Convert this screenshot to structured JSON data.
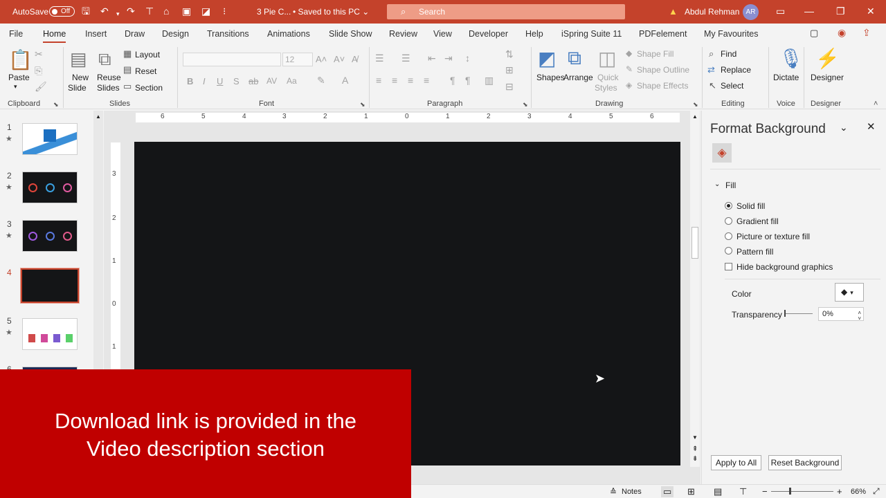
{
  "titlebar": {
    "autosave": "AutoSave",
    "toggle": "Off",
    "doc_title": "3 Pie C...",
    "saved": "• Saved to this PC ⌄",
    "search_placeholder": "Search",
    "user": "Abdul Rehman",
    "avatar": "AR",
    "accent": "#c4422b"
  },
  "tabs": [
    "File",
    "Home",
    "Insert",
    "Draw",
    "Design",
    "Transitions",
    "Animations",
    "Slide Show",
    "Review",
    "View",
    "Developer",
    "Help",
    "iSpring Suite 11",
    "PDFelement",
    "My Favourites"
  ],
  "ribbon": {
    "clipboard": {
      "paste": "Paste",
      "group": "Clipboard"
    },
    "slides": {
      "new_slide": "New",
      "new_slide2": "Slide",
      "reuse": "Reuse",
      "reuse2": "Slides",
      "layout": "Layout",
      "reset": "Reset",
      "section": "Section",
      "group": "Slides"
    },
    "font": {
      "size": "12",
      "group": "Font"
    },
    "paragraph": {
      "group": "Paragraph"
    },
    "drawing": {
      "shapes": "Shapes",
      "arrange": "Arrange",
      "quick": "Quick",
      "quick2": "Styles",
      "shape_fill": "Shape Fill",
      "shape_outline": "Shape Outline",
      "shape_effects": "Shape Effects",
      "group": "Drawing"
    },
    "editing": {
      "find": "Find",
      "replace": "Replace",
      "select": "Select",
      "group": "Editing"
    },
    "voice": {
      "dictate": "Dictate",
      "group": "Voice"
    },
    "designer": {
      "designer": "Designer",
      "group": "Designer"
    }
  },
  "thumbnails": [
    {
      "num": "1",
      "star": "★"
    },
    {
      "num": "2",
      "star": "★"
    },
    {
      "num": "3",
      "star": "★"
    },
    {
      "num": "4",
      "star": ""
    },
    {
      "num": "5",
      "star": "★"
    },
    {
      "num": "6",
      "star": ""
    }
  ],
  "ruler": {
    "h": [
      "6",
      "5",
      "4",
      "3",
      "2",
      "1",
      "0",
      "1",
      "2",
      "3",
      "4",
      "5",
      "6"
    ],
    "v": [
      "3",
      "2",
      "1",
      "0",
      "1"
    ]
  },
  "pane": {
    "title": "Format Background",
    "section": "Fill",
    "options": [
      "Solid fill",
      "Gradient fill",
      "Picture or texture fill",
      "Pattern fill"
    ],
    "hide_bg": "Hide background graphics",
    "color_label": "Color",
    "transparency_label": "Transparency",
    "transparency_value": "0%",
    "apply_all": "Apply to All",
    "reset_bg": "Reset Background"
  },
  "status": {
    "notes": "Notes",
    "zoom": "66%"
  },
  "banner": {
    "line1": "Download link is provided in the",
    "line2": "Video description section"
  }
}
